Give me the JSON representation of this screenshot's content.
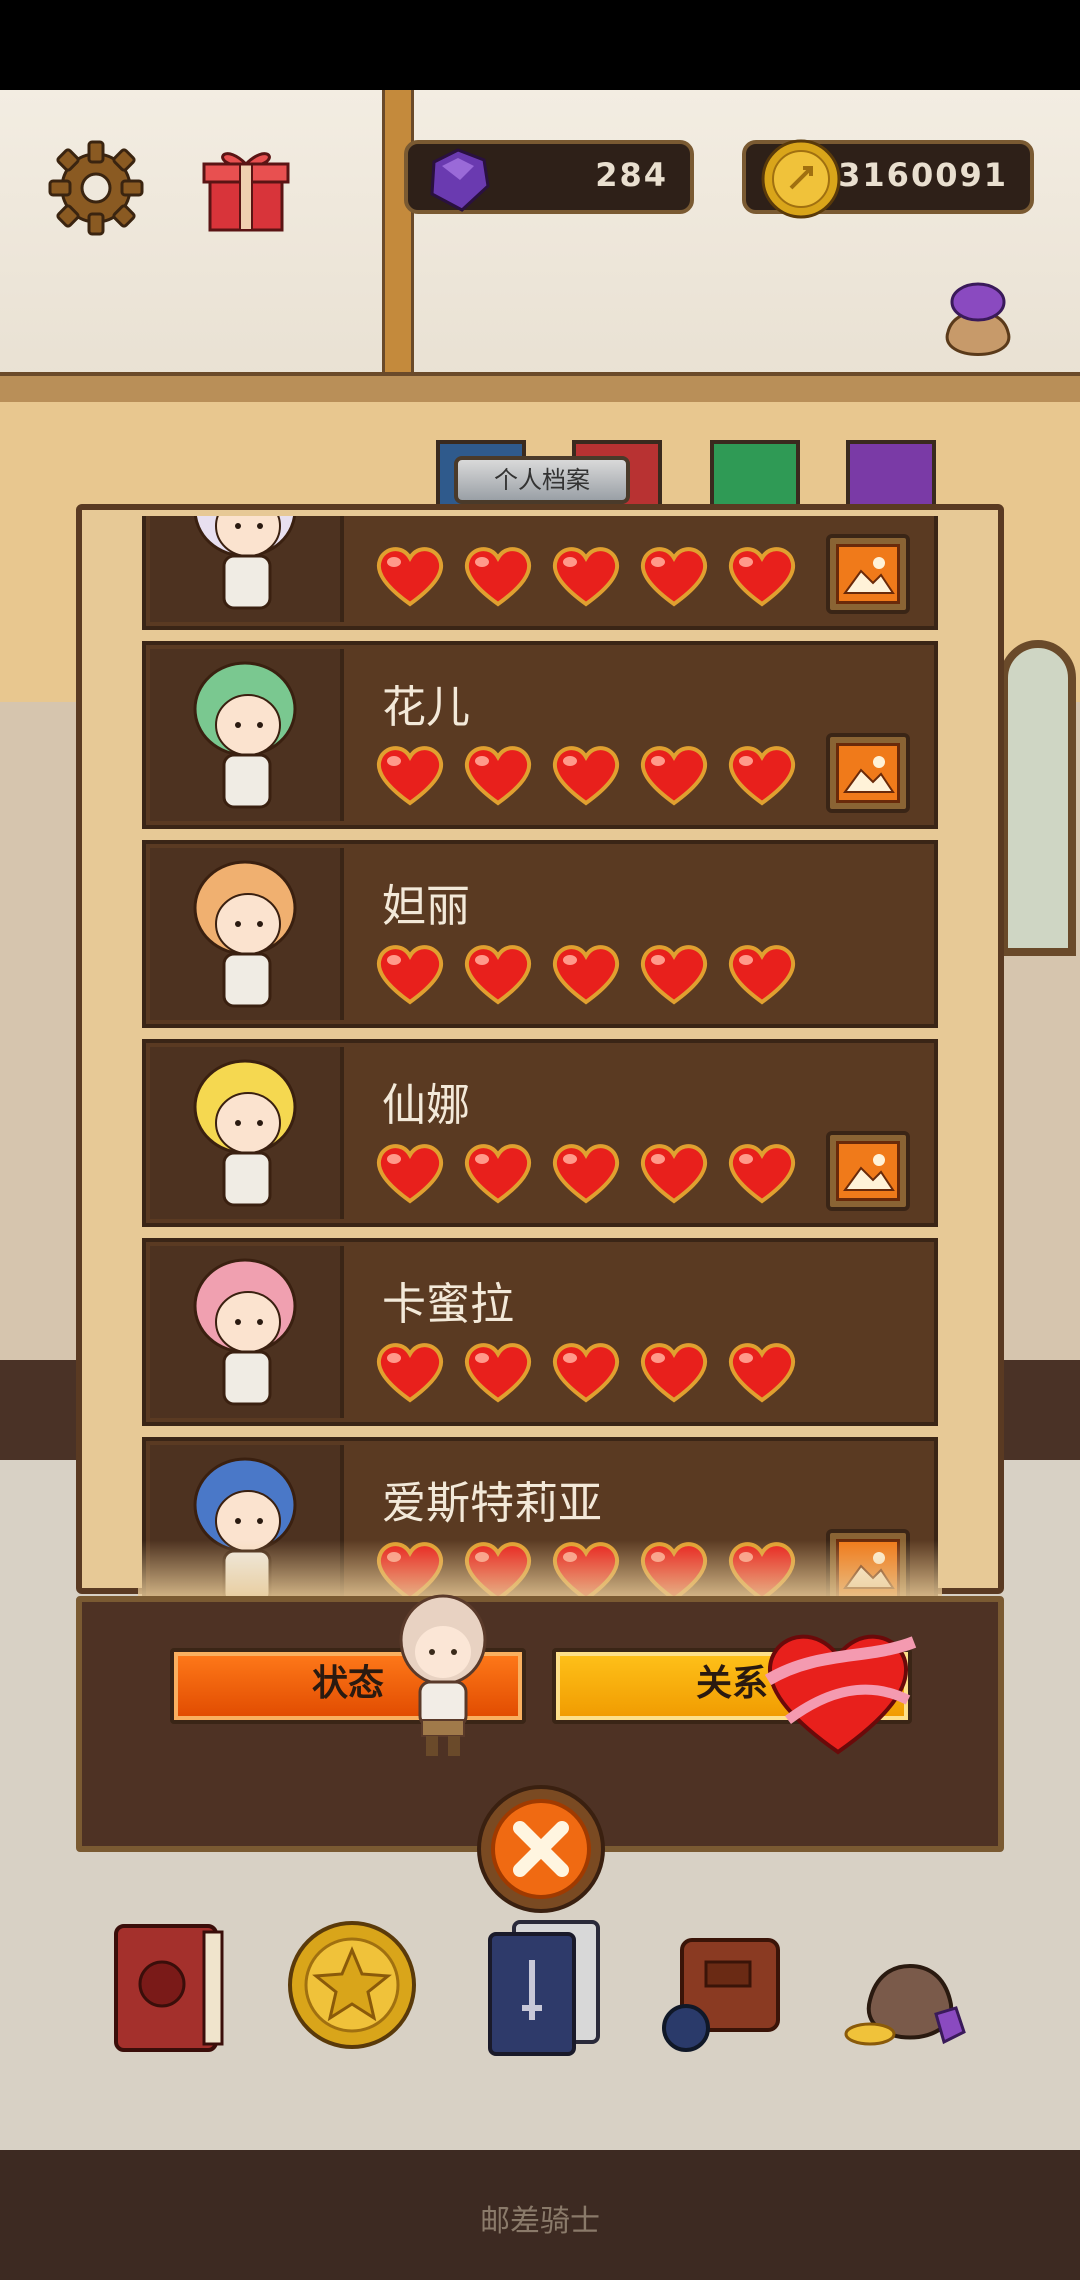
{
  "hud": {
    "gems": "284",
    "coins": "3160091"
  },
  "profile_tab": "个人档案",
  "characters": [
    {
      "name": "",
      "hearts": 5,
      "has_album": true
    },
    {
      "name": "花儿",
      "hearts": 5,
      "has_album": true
    },
    {
      "name": "妲丽",
      "hearts": 5,
      "has_album": false
    },
    {
      "name": "仙娜",
      "hearts": 5,
      "has_album": true
    },
    {
      "name": "卡蜜拉",
      "hearts": 5,
      "has_album": false
    },
    {
      "name": "爱斯特莉亚",
      "hearts": 5,
      "has_album": true
    }
  ],
  "buttons": {
    "status": "状态",
    "relation": "关系"
  },
  "nav": [
    "book-icon",
    "star-coin-icon",
    "card-deck-icon",
    "backpack-icon",
    "treasure-sack-icon"
  ],
  "watermark": "邮差骑士",
  "colors": {
    "heart": "#e8201c",
    "panel": "#5a3a22",
    "status_button": "#f05a0a",
    "relation_button": "#ffb80a"
  }
}
